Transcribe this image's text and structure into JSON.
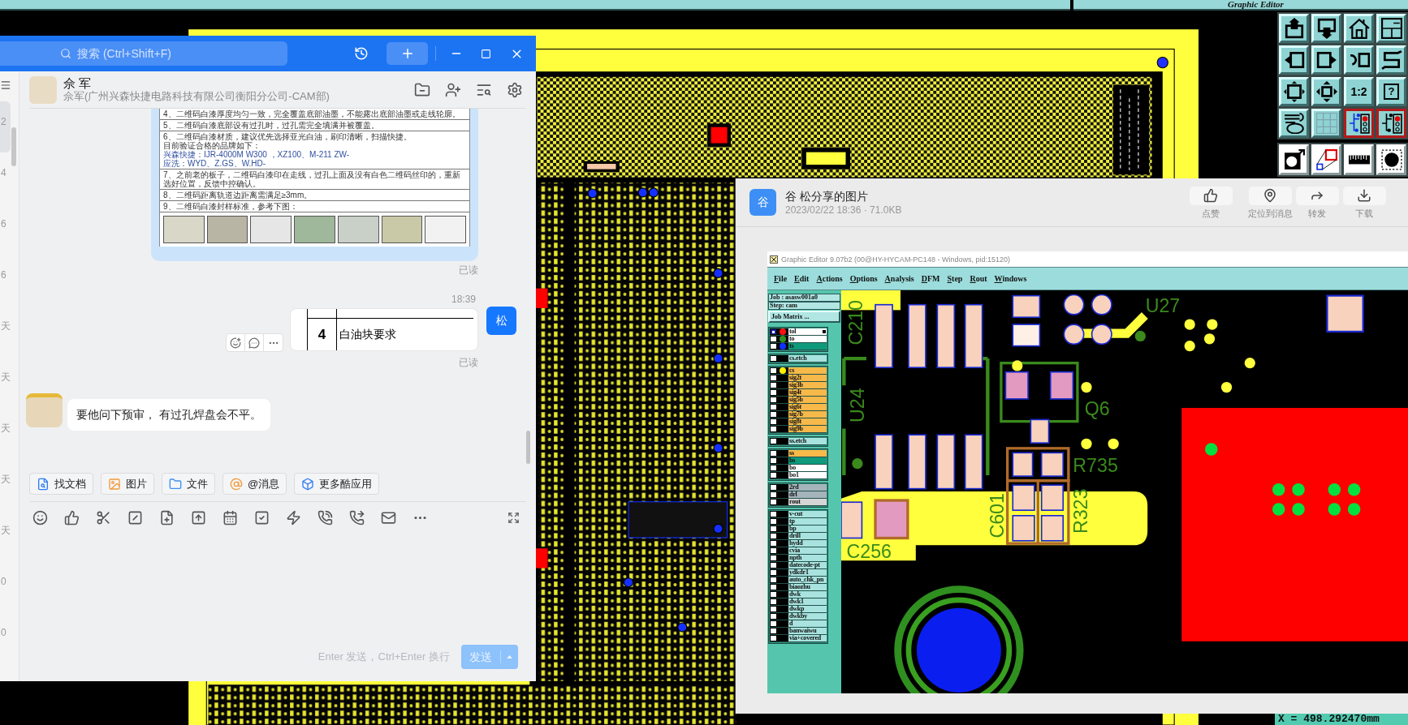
{
  "editor": {
    "title": "Graphic Editor",
    "toolbar": [
      {
        "kind": "up",
        "selected": false
      },
      {
        "kind": "down",
        "selected": false
      },
      {
        "kind": "home",
        "selected": false
      },
      {
        "kind": "window",
        "selected": false
      },
      {
        "kind": "left",
        "selected": false
      },
      {
        "kind": "right",
        "selected": false
      },
      {
        "kind": "undo",
        "selected": false
      },
      {
        "kind": "snake",
        "selected": false
      },
      {
        "kind": "expand",
        "selected": false
      },
      {
        "kind": "center",
        "selected": false
      },
      {
        "kind": "ratio",
        "label": "1:2",
        "selected": false
      },
      {
        "kind": "help",
        "label": "?",
        "selected": false
      },
      {
        "kind": "tools",
        "selected": false
      },
      {
        "kind": "grid",
        "selected": false
      },
      {
        "kind": "net-blue",
        "selected": true
      },
      {
        "kind": "net-black",
        "selected": true
      }
    ],
    "toolbar_lower": [
      {
        "kind": "select"
      },
      {
        "kind": "zoom-box"
      },
      {
        "kind": "ruler"
      },
      {
        "kind": "dot"
      }
    ],
    "coordinate_readout": "X = 498.292470mm"
  },
  "chat_window": {
    "search": {
      "placeholder": "搜索 (Ctrl+Shift+F)"
    },
    "list_fragments": [
      {
        "text": "2",
        "selected": true
      },
      {
        "text": "4",
        "selected": false
      },
      {
        "text": "6",
        "selected": false
      },
      {
        "text": "6",
        "selected": false
      },
      {
        "text": "天",
        "selected": false
      },
      {
        "text": "天",
        "selected": false
      },
      {
        "text": "天",
        "selected": false
      },
      {
        "text": "天",
        "selected": false
      },
      {
        "text": "天",
        "selected": false
      },
      {
        "text": "0",
        "selected": false
      },
      {
        "text": "0",
        "selected": false
      }
    ],
    "contact": {
      "name": "佘 军",
      "subtitle": "佘军(广州兴森快捷电路科技有限公司衡阳分公司-CAM部)"
    },
    "messages": [
      {
        "kind": "document-image",
        "read": "已读",
        "rows": [
          {
            "lines": [
              {
                "text": "4、二维码白漆厚度均匀一致，完全覆盖底部油墨，不能露出底部油墨或走线轮廓。"
              }
            ]
          },
          {
            "lines": [
              {
                "text": "5、二维码白漆底部设有过孔时，过孔需完全填满并被覆盖。"
              }
            ]
          },
          {
            "lines": [
              {
                "text": "6、二维码白漆材质，建议优先选择亚光白油，刷印清晰，扫描快捷。"
              },
              {
                "text": "目前验证合格的品牌如下："
              },
              {
                "text": "兴森快捷：IJR-4000M W300 ，XZ100、M-211 ZW-",
                "color": "#2f4f9f"
              },
              {
                "text": "应洗：WYD、Z.GS、W.HD-",
                "color": "#2f4f9f"
              }
            ]
          },
          {
            "lines": [
              {
                "text": "7、之前老的板子，二维码白漆印在走线，过孔上面及没有白色二维码丝印的，重新选好位置，反馈中控确认。"
              }
            ]
          },
          {
            "lines": [
              {
                "text": "8、二维码距离轨道边距离需满足≥3mm。"
              }
            ]
          },
          {
            "lines": [
              {
                "text": "9、二维码白漆封样标准，参考下图："
              }
            ]
          }
        ]
      },
      {
        "kind": "time",
        "text": "18:39"
      },
      {
        "kind": "table-snippet",
        "number": "4",
        "text": "白油块要求",
        "sender": "松",
        "read": "已读"
      },
      {
        "kind": "text",
        "text": "要他问下预审， 有过孔焊盘会不平。"
      }
    ],
    "quick_actions": [
      {
        "kind": "doc",
        "label": "找文档"
      },
      {
        "kind": "image",
        "label": "图片"
      },
      {
        "kind": "folder",
        "label": "文件"
      },
      {
        "kind": "mention",
        "label": "@消息"
      },
      {
        "kind": "apps",
        "label": "更多酷应用"
      }
    ],
    "send_hint": "Enter 发送，Ctrl+Enter 换行",
    "send_button": {
      "label": "发送",
      "disabled": true
    }
  },
  "image_viewer": {
    "sender_initial": "谷",
    "title": "谷 松分享的图片",
    "meta": "2023/02/22 18:36 · 71.0KB",
    "actions": [
      {
        "kind": "like",
        "label": "点赞"
      },
      {
        "kind": "locate",
        "label": "定位到消息"
      },
      {
        "kind": "forward",
        "label": "转发"
      },
      {
        "kind": "download",
        "label": "下载"
      }
    ],
    "shared_image": {
      "window_title": "Graphic Editor 9.07b2 (00@HY-HYCAM-PC148 - Windows, pid:15120)",
      "menu": [
        "File",
        "Edit",
        "Actions",
        "Options",
        "Analysis",
        "DFM",
        "Step",
        "Rout",
        "Windows"
      ],
      "job": "Job : asasw001a0",
      "step": "Step: cam",
      "job_matrix": "Job Matrix ...",
      "layer_groups": [
        {
          "layers": [
            {
              "name": "tol",
              "color": "#ffffff",
              "dot": {
                "color": "#ff1010"
              },
              "checked": true,
              "active": true
            },
            {
              "name": "to",
              "color": "#ffffff",
              "dot": {
                "color": "#2f8f1f"
              },
              "checked": false,
              "active": false
            },
            {
              "name": "ts",
              "color": "#0f9a7c",
              "dot": {
                "color": "#1030ff"
              },
              "checked": false,
              "active": false
            }
          ]
        },
        {
          "layers": [
            {
              "name": "cs.etch",
              "color": "#a9e3df",
              "checked": false,
              "active": false
            }
          ]
        },
        {
          "layers": [
            {
              "name": "cs",
              "color": "#f6b94a",
              "dot": {
                "color": "#ffee00"
              },
              "checked": false,
              "active": false
            },
            {
              "name": "sig2t",
              "color": "#f6b94a",
              "checked": false,
              "active": false
            },
            {
              "name": "sig3b",
              "color": "#f6b94a",
              "checked": false,
              "active": false
            },
            {
              "name": "sig4t",
              "color": "#f6b94a",
              "checked": false,
              "active": false
            },
            {
              "name": "sig5b",
              "color": "#f6b94a",
              "checked": false,
              "active": false
            },
            {
              "name": "sig6t",
              "color": "#f6b94a",
              "checked": false,
              "active": false
            },
            {
              "name": "sig7b",
              "color": "#f6b94a",
              "checked": false,
              "active": false
            },
            {
              "name": "sig8t",
              "color": "#f6b94a",
              "checked": false,
              "active": false
            },
            {
              "name": "sig9b",
              "color": "#f6b94a",
              "checked": false,
              "active": false
            }
          ]
        },
        {
          "layers": [
            {
              "name": "ss.etch",
              "color": "#a9e3df",
              "checked": false,
              "active": false
            }
          ]
        },
        {
          "layers": [
            {
              "name": "ss",
              "color": "#f6b94a",
              "checked": false,
              "active": false
            },
            {
              "name": "bs",
              "color": "#0f9a7c",
              "checked": false,
              "active": false
            },
            {
              "name": "bo",
              "color": "#ffffff",
              "checked": false,
              "active": false
            },
            {
              "name": "bo1",
              "color": "#ffffff",
              "checked": false,
              "active": false
            }
          ]
        },
        {
          "layers": [
            {
              "name": "2rd",
              "color": "#a5b4bb",
              "checked": false,
              "active": false
            },
            {
              "name": "drl",
              "color": "#a5b4bb",
              "checked": false,
              "active": false
            },
            {
              "name": "rout",
              "color": "#d5d5d5",
              "checked": false,
              "active": false
            }
          ]
        },
        {
          "layers": [
            {
              "name": "v-cut",
              "color": "#a9e3df",
              "checked": false,
              "active": false
            },
            {
              "name": "tp",
              "color": "#a9e3df",
              "checked": false,
              "active": false
            },
            {
              "name": "bp",
              "color": "#a9e3df",
              "checked": false,
              "active": false
            },
            {
              "name": "drill",
              "color": "#a9e3df",
              "checked": false,
              "active": false
            },
            {
              "name": "hydd",
              "color": "#a9e3df",
              "checked": false,
              "active": false
            },
            {
              "name": "cvia",
              "color": "#a9e3df",
              "checked": false,
              "active": false
            },
            {
              "name": "npth",
              "color": "#a9e3df",
              "checked": false,
              "active": false
            },
            {
              "name": "datecode-pt",
              "color": "#a9e3df",
              "checked": false,
              "active": false
            },
            {
              "name": "ydkdr1",
              "color": "#a9e3df",
              "checked": false,
              "active": false
            },
            {
              "name": "auto_chk_pn",
              "color": "#a9e3df",
              "checked": false,
              "active": false
            },
            {
              "name": "biaozhu",
              "color": "#a9e3df",
              "checked": false,
              "active": false
            },
            {
              "name": "dwk",
              "color": "#a9e3df",
              "checked": false,
              "active": false
            },
            {
              "name": "dwk1",
              "color": "#a9e3df",
              "checked": false,
              "active": false
            },
            {
              "name": "dwkp",
              "color": "#a9e3df",
              "checked": false,
              "active": false
            },
            {
              "name": "dwkby",
              "color": "#a9e3df",
              "checked": false,
              "active": false
            },
            {
              "name": "d",
              "color": "#a9e3df",
              "checked": false,
              "active": false
            },
            {
              "name": "banwaiwu",
              "color": "#a9e3df",
              "checked": false,
              "active": false
            },
            {
              "name": "via+covered",
              "color": "#a9e3df",
              "checked": false,
              "active": false
            }
          ]
        }
      ],
      "silkscreen_labels": [
        "C210",
        "U27",
        "U24",
        "Q6",
        "R735",
        "C601",
        "R323",
        "C256"
      ]
    }
  }
}
